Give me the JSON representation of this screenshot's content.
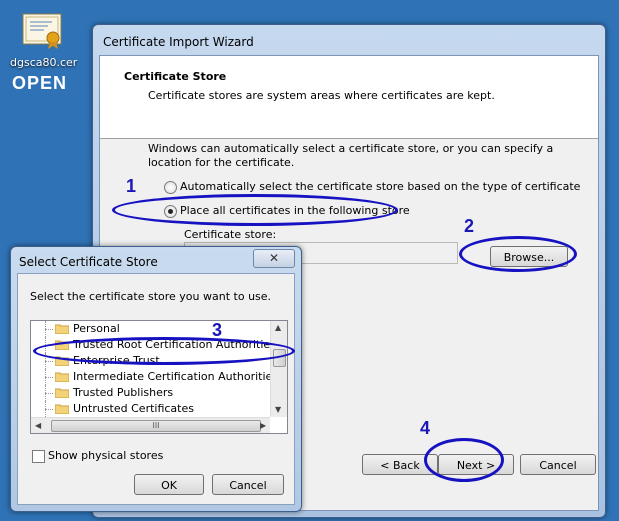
{
  "desktop": {
    "icon_name": "certificate-file-icon",
    "filename": "dgsca80.cer",
    "open_label": "OPEN"
  },
  "wizard": {
    "title": "Certificate Import Wizard",
    "heading": "Certificate Store",
    "description": "Certificate stores are system areas where certificates are kept.",
    "auto_text": "Windows can automatically select a certificate store, or you can specify a location for the certificate.",
    "radio_auto_label": "Automatically select the certificate store based on the type of certificate",
    "radio_place_label": "Place all certificates in the following store",
    "store_label": "Certificate store:",
    "store_value": "",
    "browse_label": "Browse...",
    "back_label": "< Back",
    "next_label": "Next >",
    "cancel_label": "Cancel"
  },
  "dialog": {
    "title": "Select Certificate Store",
    "close_glyph": "✕",
    "prompt": "Select the certificate store you want to use.",
    "stores": [
      "Personal",
      "Trusted Root Certification Authorities",
      "Enterprise Trust",
      "Intermediate Certification Authorities",
      "Trusted Publishers",
      "Untrusted Certificates"
    ],
    "scroll_up": "▲",
    "scroll_down": "▼",
    "scroll_left": "◀",
    "scroll_right": "▶",
    "scroll_grip": "III",
    "physical_label": "Show physical stores",
    "ok_label": "OK",
    "cancel_label": "Cancel"
  },
  "annotations": {
    "step1": "1",
    "step2": "2",
    "step3": "3",
    "step4": "4",
    "color": "#1612c2"
  }
}
